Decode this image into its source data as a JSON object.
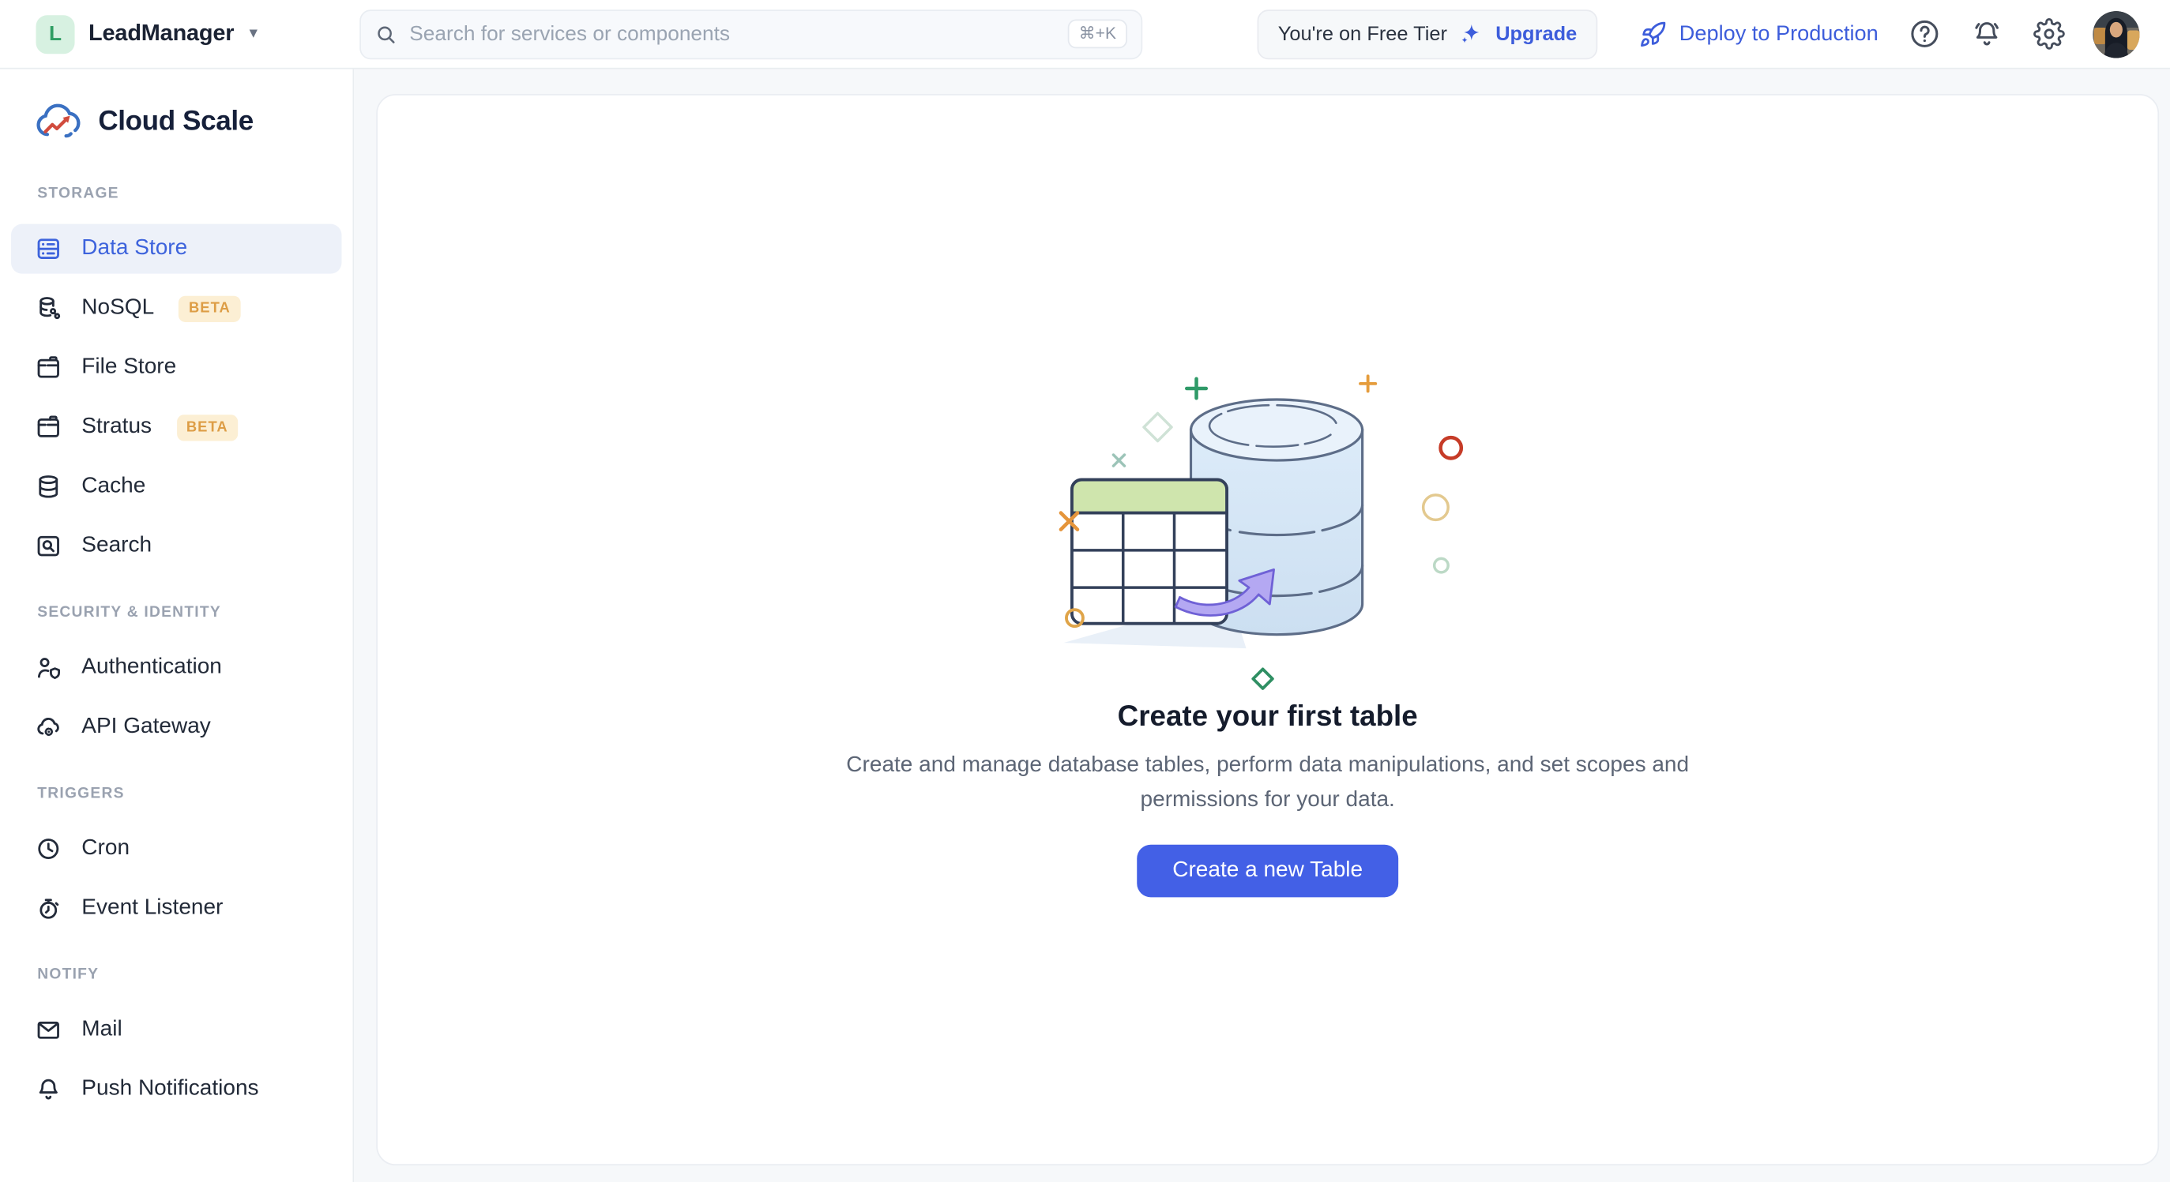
{
  "topbar": {
    "project": {
      "initial": "L",
      "name": "LeadManager"
    },
    "search": {
      "placeholder": "Search for services or components",
      "shortcut": "⌘+K"
    },
    "tier": {
      "text": "You're on Free Tier",
      "upgrade_label": "Upgrade"
    },
    "deploy_label": "Deploy to Production",
    "icons": [
      "help-icon",
      "notifications-bell-icon",
      "settings-gear-icon",
      "user-avatar"
    ]
  },
  "sidebar": {
    "brand": "Cloud Scale",
    "logo_icon": "cloud-growth-logo",
    "sections": [
      {
        "label": "STORAGE",
        "items": [
          {
            "label": "Data Store",
            "icon": "data-store-icon",
            "active": true
          },
          {
            "label": "NoSQL",
            "icon": "nosql-icon",
            "badge": "BETA"
          },
          {
            "label": "File Store",
            "icon": "file-store-icon"
          },
          {
            "label": "Stratus",
            "icon": "stratus-icon",
            "badge": "BETA"
          },
          {
            "label": "Cache",
            "icon": "cache-icon"
          },
          {
            "label": "Search",
            "icon": "search-box-icon"
          }
        ]
      },
      {
        "label": "SECURITY & IDENTITY",
        "items": [
          {
            "label": "Authentication",
            "icon": "authentication-icon"
          },
          {
            "label": "API Gateway",
            "icon": "api-gateway-icon"
          }
        ]
      },
      {
        "label": "TRIGGERS",
        "items": [
          {
            "label": "Cron",
            "icon": "cron-clock-icon"
          },
          {
            "label": "Event Listener",
            "icon": "event-listener-icon"
          }
        ]
      },
      {
        "label": "NOTIFY",
        "items": [
          {
            "label": "Mail",
            "icon": "mail-icon"
          },
          {
            "label": "Push Notifications",
            "icon": "push-notifications-icon"
          }
        ]
      }
    ]
  },
  "main": {
    "empty_state": {
      "illustration": "database-table-illustration",
      "title": "Create your first table",
      "description": "Create and manage database tables, perform data manipulations, and set scopes and permissions for your data.",
      "cta_label": "Create a new Table"
    }
  },
  "colors": {
    "accent_button": "#4360e6",
    "link_blue": "#3d5ddb",
    "active_item_blue": "#3d63dc",
    "active_item_bg": "#edf1f9",
    "beta_badge_bg": "#fcefd4",
    "beta_badge_text": "#dd9d45",
    "project_badge_bg": "#d7f1e1",
    "project_badge_text": "#2f9e63",
    "content_bg": "#f6f8fa"
  }
}
